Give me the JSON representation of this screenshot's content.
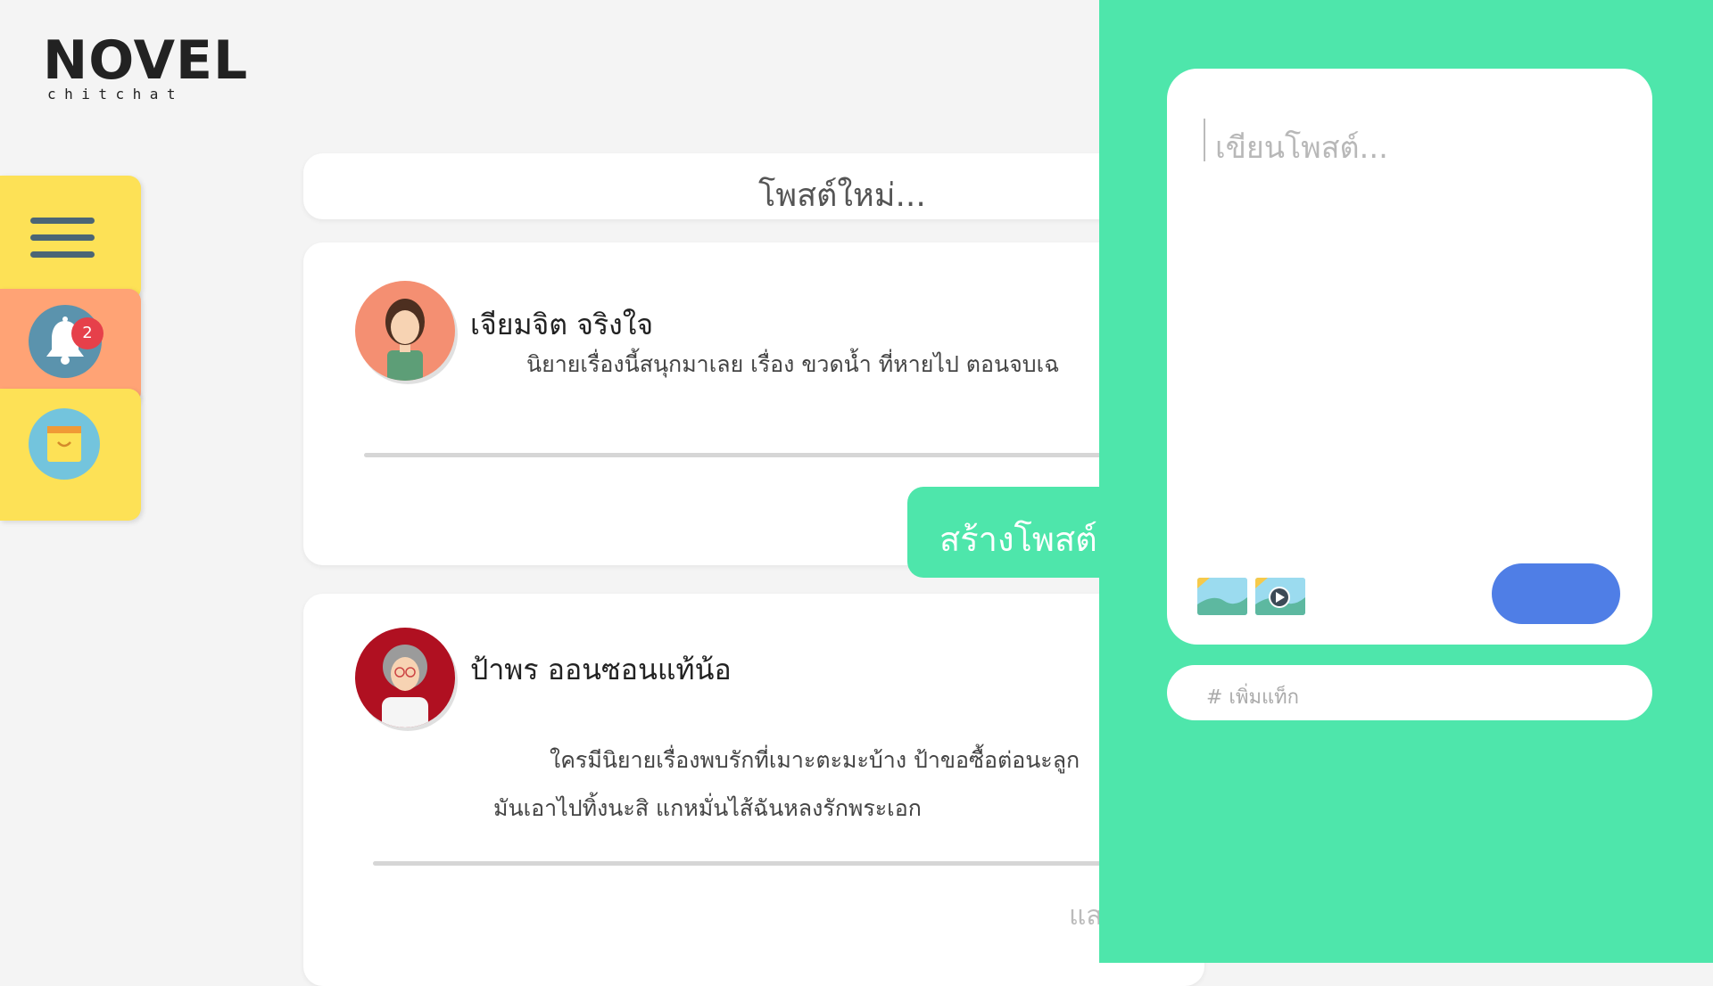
{
  "logo": {
    "main": "NOVEL",
    "sub": "chitchat"
  },
  "sidebar": {
    "menu_icon": "hamburger-menu-icon",
    "notification": {
      "icon": "bell-icon",
      "count": "2"
    },
    "shop_icon": "shopping-bag-icon"
  },
  "feed": {
    "new_post_placeholder": "โพสต์ใหม่...",
    "posts": [
      {
        "author": "เจียมจิต จริงใจ",
        "lines": [
          "นิยายเรื่องนี้สนุกมาเลย เรื่อง ขวดน้ำ ที่หายไป ตอนจบเฉ"
        ]
      },
      {
        "author": "ป้าพร ออนซอนแท้น้อ",
        "lines": [
          "ใครมีนิยายเรื่องพบรักที่เมาะตะมะบ้าง ป้าขอซื้อต่อนะลูก",
          "มันเอาไปทิ้งนะสิ แกหมั่นไส้ฉันหลงรักพระเอก"
        ],
        "trailing": "แส"
      }
    ],
    "create_button": "สร้างโพสต์"
  },
  "compose": {
    "placeholder": "เขียนโพสต์...",
    "tag_placeholder": "# เพิ่มแท็ก",
    "image_icon": "image-icon",
    "video_icon": "video-icon"
  },
  "colors": {
    "panel": "#4ee6ab",
    "sidebar_yellow": "#fde156",
    "sidebar_orange": "#ffa375",
    "send_button": "#4f7ee6",
    "badge": "#e6404a"
  }
}
